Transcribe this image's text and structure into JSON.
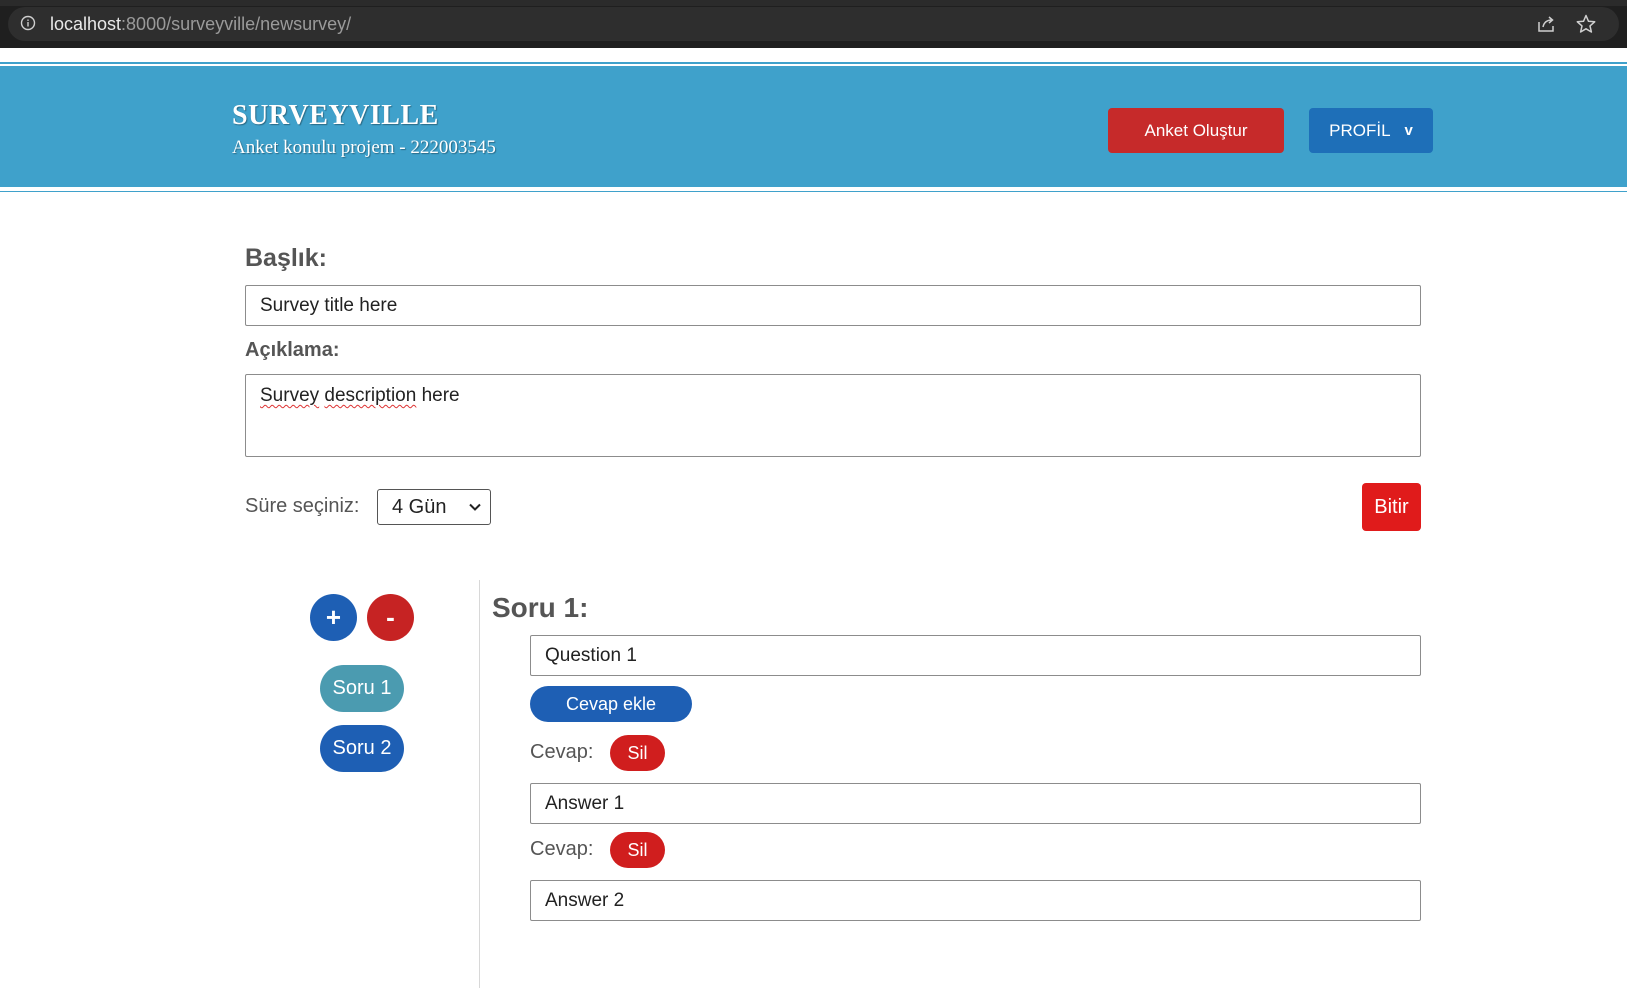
{
  "browser": {
    "url_host": "localhost",
    "url_rest": ":8000/surveyville/newsurvey/"
  },
  "header": {
    "brand": "SURVEYVILLE",
    "tagline": "Anket konulu projem - 222003545",
    "create_label": "Anket Oluştur",
    "profile_label": "PROFİL",
    "profile_caret": "v"
  },
  "form": {
    "title_label": "Başlık:",
    "title_value": "Survey title here",
    "desc_label": "Açıklama:",
    "desc_word1": "Survey",
    "desc_word2": "description",
    "desc_word3": "here",
    "duration_label": "Süre seçiniz:",
    "duration_value": "4 Gün",
    "finish_label": "Bitir"
  },
  "questions": {
    "add_label": "+",
    "remove_label": "-",
    "nav": [
      "Soru 1",
      "Soru 2"
    ],
    "heading": "Soru 1:",
    "question_value": "Question 1",
    "add_answer_label": "Cevap ekle",
    "answers": [
      {
        "label": "Cevap:",
        "delete_label": "Sil",
        "value": "Answer 1"
      },
      {
        "label": "Cevap:",
        "delete_label": "Sil",
        "value": "Answer 2"
      }
    ]
  },
  "colors": {
    "header_bg": "#3fa1cb",
    "create_btn": "#c62a2a",
    "profile_btn": "#1e6fb8",
    "finish_btn": "#e01b1b",
    "primary_blue": "#1e5fb4",
    "active_pill": "#4b9bb0",
    "delete_red": "#d01e1e"
  }
}
